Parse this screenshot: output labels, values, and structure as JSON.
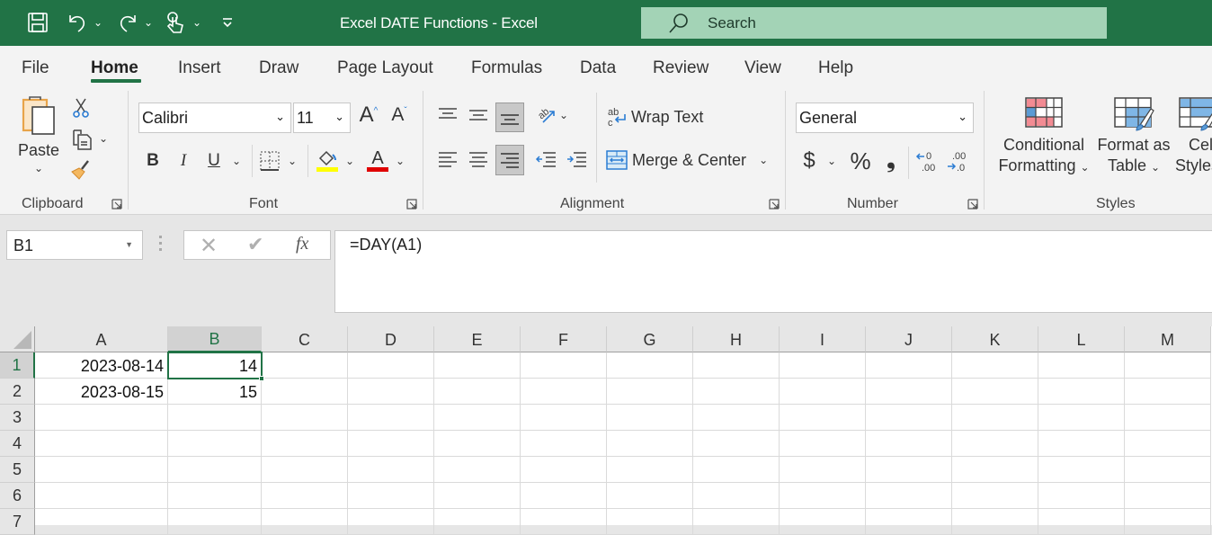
{
  "window": {
    "title": "Excel DATE Functions  -  Excel",
    "search_placeholder": "Search",
    "accent": "#217346"
  },
  "quick_access": [
    {
      "name": "save-icon"
    },
    {
      "name": "undo-icon"
    },
    {
      "name": "redo-icon"
    },
    {
      "name": "touch-mode-icon"
    },
    {
      "name": "customize-qat-icon"
    }
  ],
  "tabs": [
    {
      "label": "File",
      "active": false
    },
    {
      "label": "Home",
      "active": true
    },
    {
      "label": "Insert",
      "active": false
    },
    {
      "label": "Draw",
      "active": false
    },
    {
      "label": "Page Layout",
      "active": false
    },
    {
      "label": "Formulas",
      "active": false
    },
    {
      "label": "Data",
      "active": false
    },
    {
      "label": "Review",
      "active": false
    },
    {
      "label": "View",
      "active": false
    },
    {
      "label": "Help",
      "active": false
    }
  ],
  "ribbon": {
    "clipboard": {
      "label": "Clipboard",
      "paste_label": "Paste"
    },
    "font": {
      "label": "Font",
      "font_name": "Calibri",
      "font_size": "11",
      "bold": "B",
      "italic": "I",
      "underline": "U",
      "highlight_color": "#ffff00",
      "font_color": "#e00000"
    },
    "alignment": {
      "label": "Alignment",
      "wrap_text": "Wrap Text",
      "merge_center": "Merge & Center"
    },
    "number": {
      "label": "Number",
      "format": "General",
      "currency": "$",
      "percent": "%",
      "comma": "❟"
    },
    "styles": {
      "label": "Styles",
      "conditional_formatting_1": "Conditional",
      "conditional_formatting_2": "Formatting",
      "format_as_table_1": "Format as",
      "format_as_table_2": "Table",
      "cell_styles_1": "Cell",
      "cell_styles_2": "Styles"
    }
  },
  "formula_bar": {
    "name_box": "B1",
    "formula": "=DAY(A1)",
    "fx": "fx"
  },
  "sheet": {
    "columns": [
      "A",
      "B",
      "C",
      "D",
      "E",
      "F",
      "G",
      "H",
      "I",
      "J",
      "K",
      "L",
      "M"
    ],
    "rows": [
      "1",
      "2",
      "3",
      "4",
      "5",
      "6",
      "7"
    ],
    "selected_cell": "B1",
    "cells": {
      "A1": "2023-08-14",
      "B1": "14",
      "A2": "2023-08-15",
      "B2": "15"
    }
  }
}
